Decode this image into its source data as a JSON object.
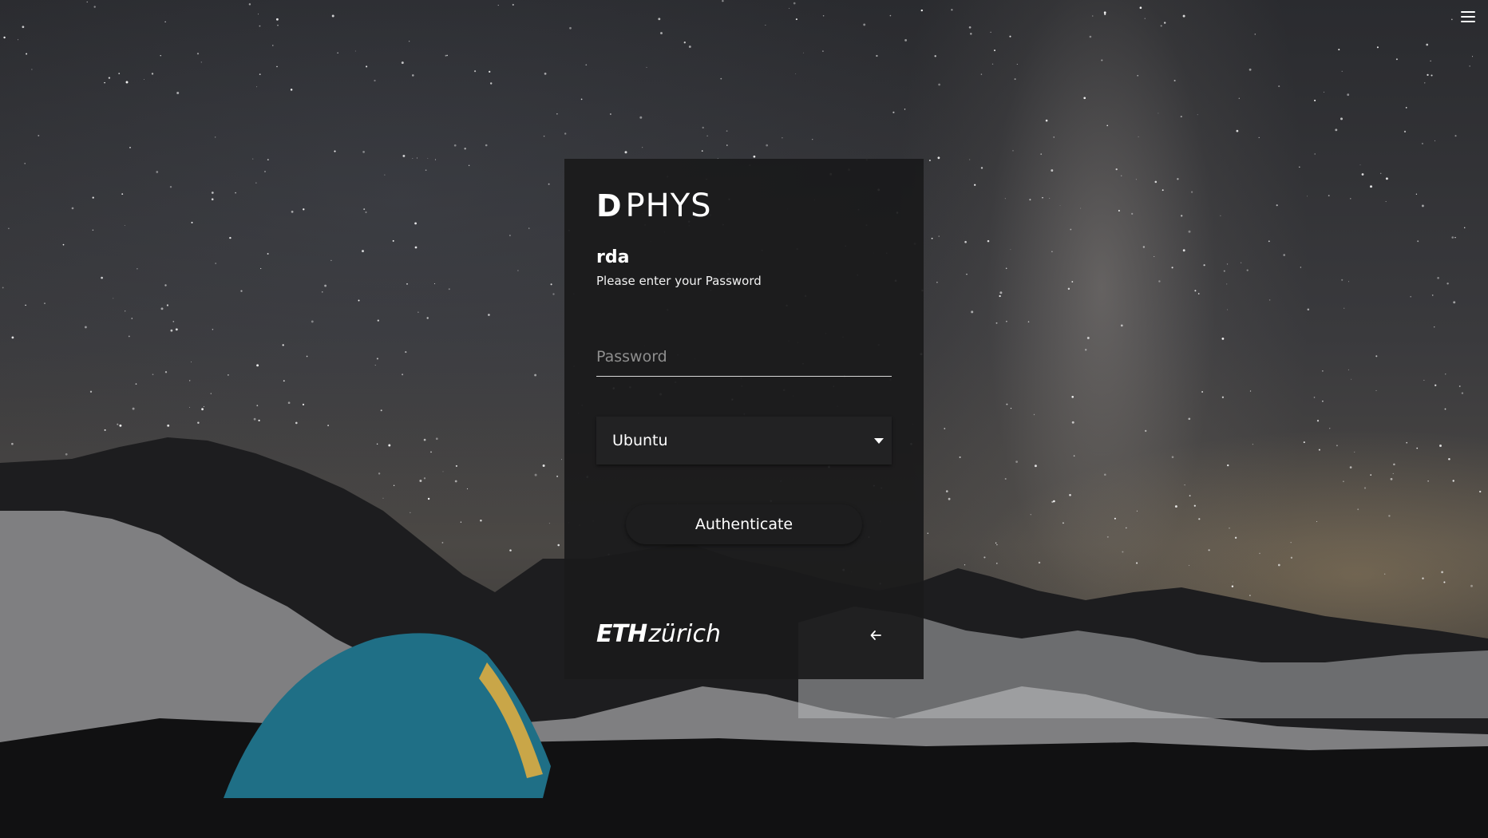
{
  "header": {
    "menu_icon": "hamburger-menu-icon"
  },
  "logo": {
    "mark": "D",
    "name": "PHYS"
  },
  "login": {
    "username": "rda",
    "instruction": "Please enter your Password",
    "password_placeholder": "Password",
    "password_value": "",
    "session": {
      "selected": "Ubuntu",
      "icon": "caret-down-icon"
    },
    "authenticate_label": "Authenticate"
  },
  "footer": {
    "eth_bold": "ETH",
    "eth_rest": "zürich",
    "back_icon": "arrow-left-icon"
  }
}
